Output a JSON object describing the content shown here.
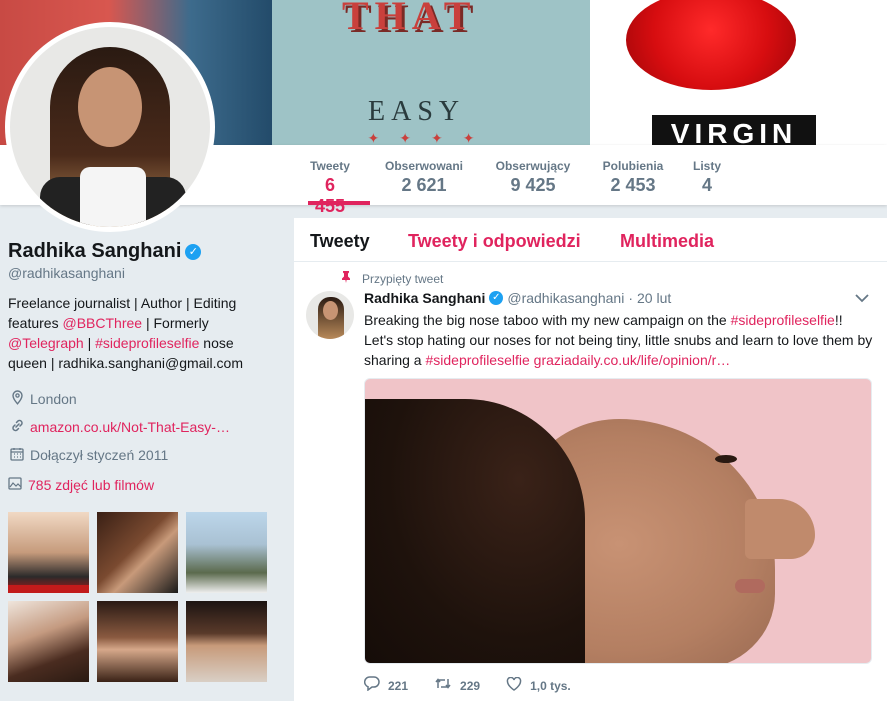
{
  "banner": {
    "book_title_partial": "THAT",
    "book_word": "EASY",
    "publisher": "VIRGIN"
  },
  "nav": {
    "stats": [
      {
        "label": "Tweety",
        "value": "6 455",
        "active": true
      },
      {
        "label": "Obserwowani",
        "value": "2 621"
      },
      {
        "label": "Obserwujący",
        "value": "9 425"
      },
      {
        "label": "Polubienia",
        "value": "2 453"
      },
      {
        "label": "Listy",
        "value": "4"
      }
    ]
  },
  "profile": {
    "name": "Radhika Sanghani",
    "verified_mark": "✓",
    "handle": "@radhikasanghani",
    "bio": {
      "p1": "Freelance journalist | Author | Editing features ",
      "m1": "@BBCThree",
      "p2": " | Formerly ",
      "m2": "@Telegraph",
      "p3": " | ",
      "h1": "#sideprofileselfie",
      "p4": " nose queen | radhika.sanghani@gmail.com"
    },
    "location": "London",
    "website": "amazon.co.uk/Not-That-Easy-…",
    "joined": "Dołączył styczeń 2011",
    "photos_label": "785 zdjęć lub filmów",
    "icons": {
      "location": "location-pin-icon",
      "link": "link-icon",
      "calendar": "calendar-icon",
      "photos": "photo-icon"
    }
  },
  "timeline": {
    "tabs": [
      "Tweety",
      "Tweety i odpowiedzi",
      "Multimedia"
    ],
    "pinned_label": "Przypięty tweet",
    "tweet": {
      "name": "Radhika Sanghani",
      "handle": "@radhikasanghani",
      "dot": "·",
      "date": "20 lut",
      "text": {
        "p1": "Breaking the big nose taboo with my new campaign on the ",
        "h1": "#sideprofileselfie",
        "p2": "!! Let's stop hating our noses for not being tiny, little snubs and learn to love them by sharing a ",
        "h2": "#sideprofileselfie",
        "p3": " ",
        "link": "graziadaily.co.uk/life/opinion/r…"
      },
      "replies": "221",
      "retweets": "229",
      "likes": "1,0 tys."
    }
  },
  "colors": {
    "accent": "#e0245e",
    "verified": "#1da1f2",
    "muted": "#657786"
  }
}
